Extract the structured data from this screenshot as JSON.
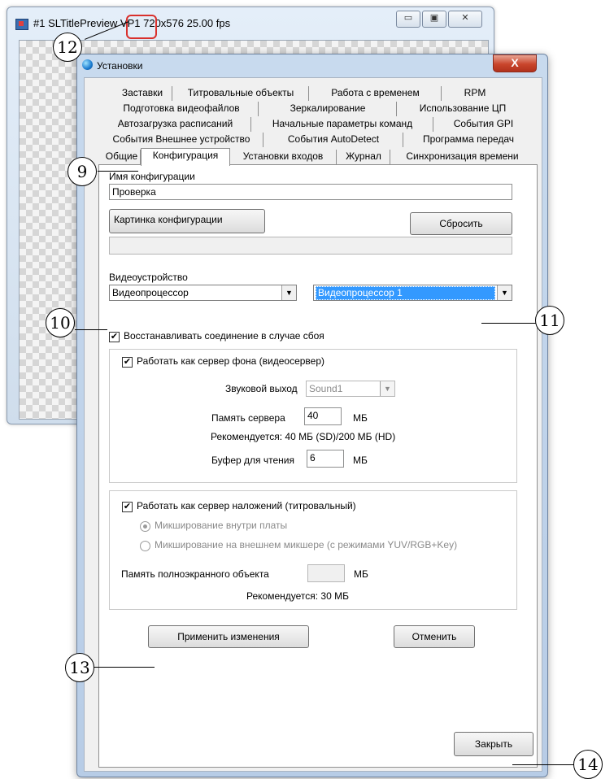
{
  "preview_window": {
    "title": "#1 SLTitlePreview VP1 720x576 25.00 fps",
    "minimize_icon": "minimize-icon",
    "maximize_icon": "maximize-icon",
    "close_icon": "close-icon",
    "minimize": "▭",
    "maximize": "▣",
    "close": "✕"
  },
  "dialog": {
    "title": "Установки",
    "close_label": "X",
    "tabs": {
      "row1": [
        "Заставки",
        "Титровальные объекты",
        "Работа с временем",
        "RPM"
      ],
      "row2": [
        "Подготовка видеофайлов",
        "Зеркалирование",
        "Использование ЦП"
      ],
      "row3": [
        "Автозагрузка расписаний",
        "Начальные параметры команд",
        "События GPI"
      ],
      "row4": [
        "События Внешнее устройство",
        "События AutoDetect",
        "Программа передач"
      ],
      "row5": [
        "Общие",
        "Конфигурация",
        "Установки входов",
        "Журнал",
        "Синхронизация времени"
      ]
    },
    "config_name_label": "Имя конфигурации",
    "config_name_value": "Проверка",
    "config_picture_button": "Картинка конфигурации",
    "reset_button": "Сбросить",
    "picture_path_value": "",
    "video_device_label": "Видеоустройство",
    "video_device_value": "Видеопроцессор",
    "video_device_instance_value": "Видеопроцессор 1",
    "restore_connection_label": "Восстанавливать соединение в случае сбоя",
    "restore_connection_checked": "✔",
    "background_server_label": "Работать как сервер фона (видеосервер)",
    "background_server_checked": "✔",
    "audio_out_label": "Звуковой выход",
    "audio_out_value": "Sound1",
    "server_memory_label": "Память сервера",
    "server_memory_value": "40",
    "mb_unit": "МБ",
    "recommended_text": "Рекомендуется: 40 МБ (SD)/200 МБ (HD)",
    "read_buffer_label": "Буфер для чтения",
    "read_buffer_value": "6",
    "overlay_server_label": "Работать как сервер наложений (титровальный)",
    "overlay_server_checked": "✔",
    "mix_internal_label": "Микширование внутри платы",
    "mix_external_label": "Микширование на внешнем микшере (с режимами YUV/RGB+Key)",
    "fullscreen_memory_label": "Память полноэкранного объекта",
    "fullscreen_memory_value": "",
    "recommended_overlay_text": "Рекомендуется: 30 МБ",
    "apply_button": "Применить изменения",
    "cancel_button": "Отменить",
    "close_button": "Закрыть"
  },
  "callouts": [
    "12",
    "9",
    "10",
    "11",
    "13",
    "14"
  ],
  "colors": {
    "highlight": "#3399ff",
    "callout_red": "#d9302c"
  }
}
